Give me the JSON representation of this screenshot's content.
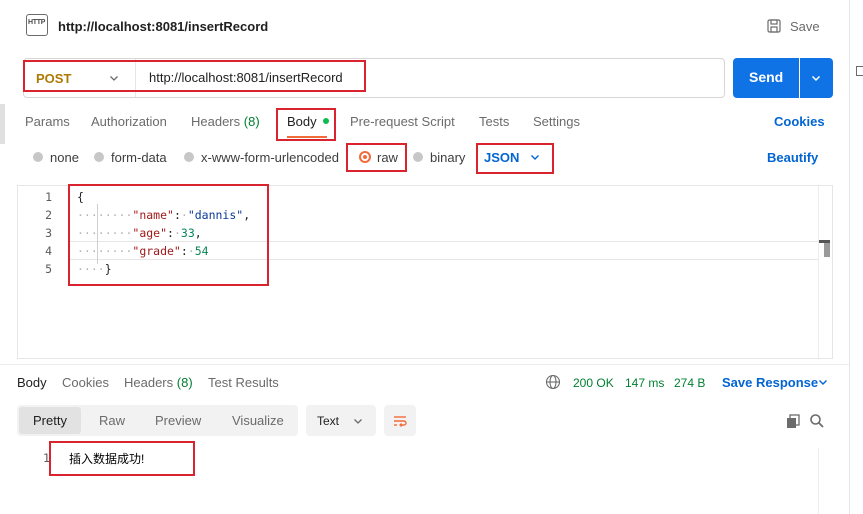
{
  "header": {
    "http_icon_text": "HTTP",
    "title": "http://localhost:8081/insertRecord",
    "save_label": "Save"
  },
  "request": {
    "method": "POST",
    "url": "http://localhost:8081/insertRecord",
    "send_label": "Send"
  },
  "req_tabs": {
    "params": "Params",
    "authorization": "Authorization",
    "headers": "Headers",
    "headers_count": "(8)",
    "body": "Body",
    "pre_request": "Pre-request Script",
    "tests": "Tests",
    "settings": "Settings",
    "cookies": "Cookies"
  },
  "body_options": {
    "none": "none",
    "form_data": "form-data",
    "urlencoded": "x-www-form-urlencoded",
    "raw": "raw",
    "binary": "binary",
    "format": "JSON",
    "beautify": "Beautify",
    "selected": "raw"
  },
  "editor": {
    "line_numbers": [
      "1",
      "2",
      "3",
      "4",
      "5"
    ],
    "open_brace": "{",
    "close_brace": "}",
    "lines": [
      {
        "key": "\"name\"",
        "value": "\"dannis\"",
        "trail": ","
      },
      {
        "key": "\"age\"",
        "value": "33",
        "trail": ","
      },
      {
        "key": "\"grade\"",
        "value": "54",
        "trail": ""
      }
    ],
    "colon": ":"
  },
  "response": {
    "tabs": {
      "body": "Body",
      "cookies": "Cookies",
      "headers": "Headers",
      "headers_count": "(8)",
      "test_results": "Test Results"
    },
    "status": "200 OK",
    "time": "147 ms",
    "size": "274 B",
    "save_response": "Save Response",
    "view_modes": [
      "Pretty",
      "Raw",
      "Preview",
      "Visualize"
    ],
    "format": "Text",
    "line_number": "1",
    "content": "插入数据成功!"
  },
  "colors": {
    "accent_blue": "#0265d2",
    "send_blue": "#0f73e6",
    "method_orange": "#ad7a03",
    "highlight_red": "#d9232e",
    "status_green": "#007f31",
    "body_dot_green": "#0cbb52"
  }
}
